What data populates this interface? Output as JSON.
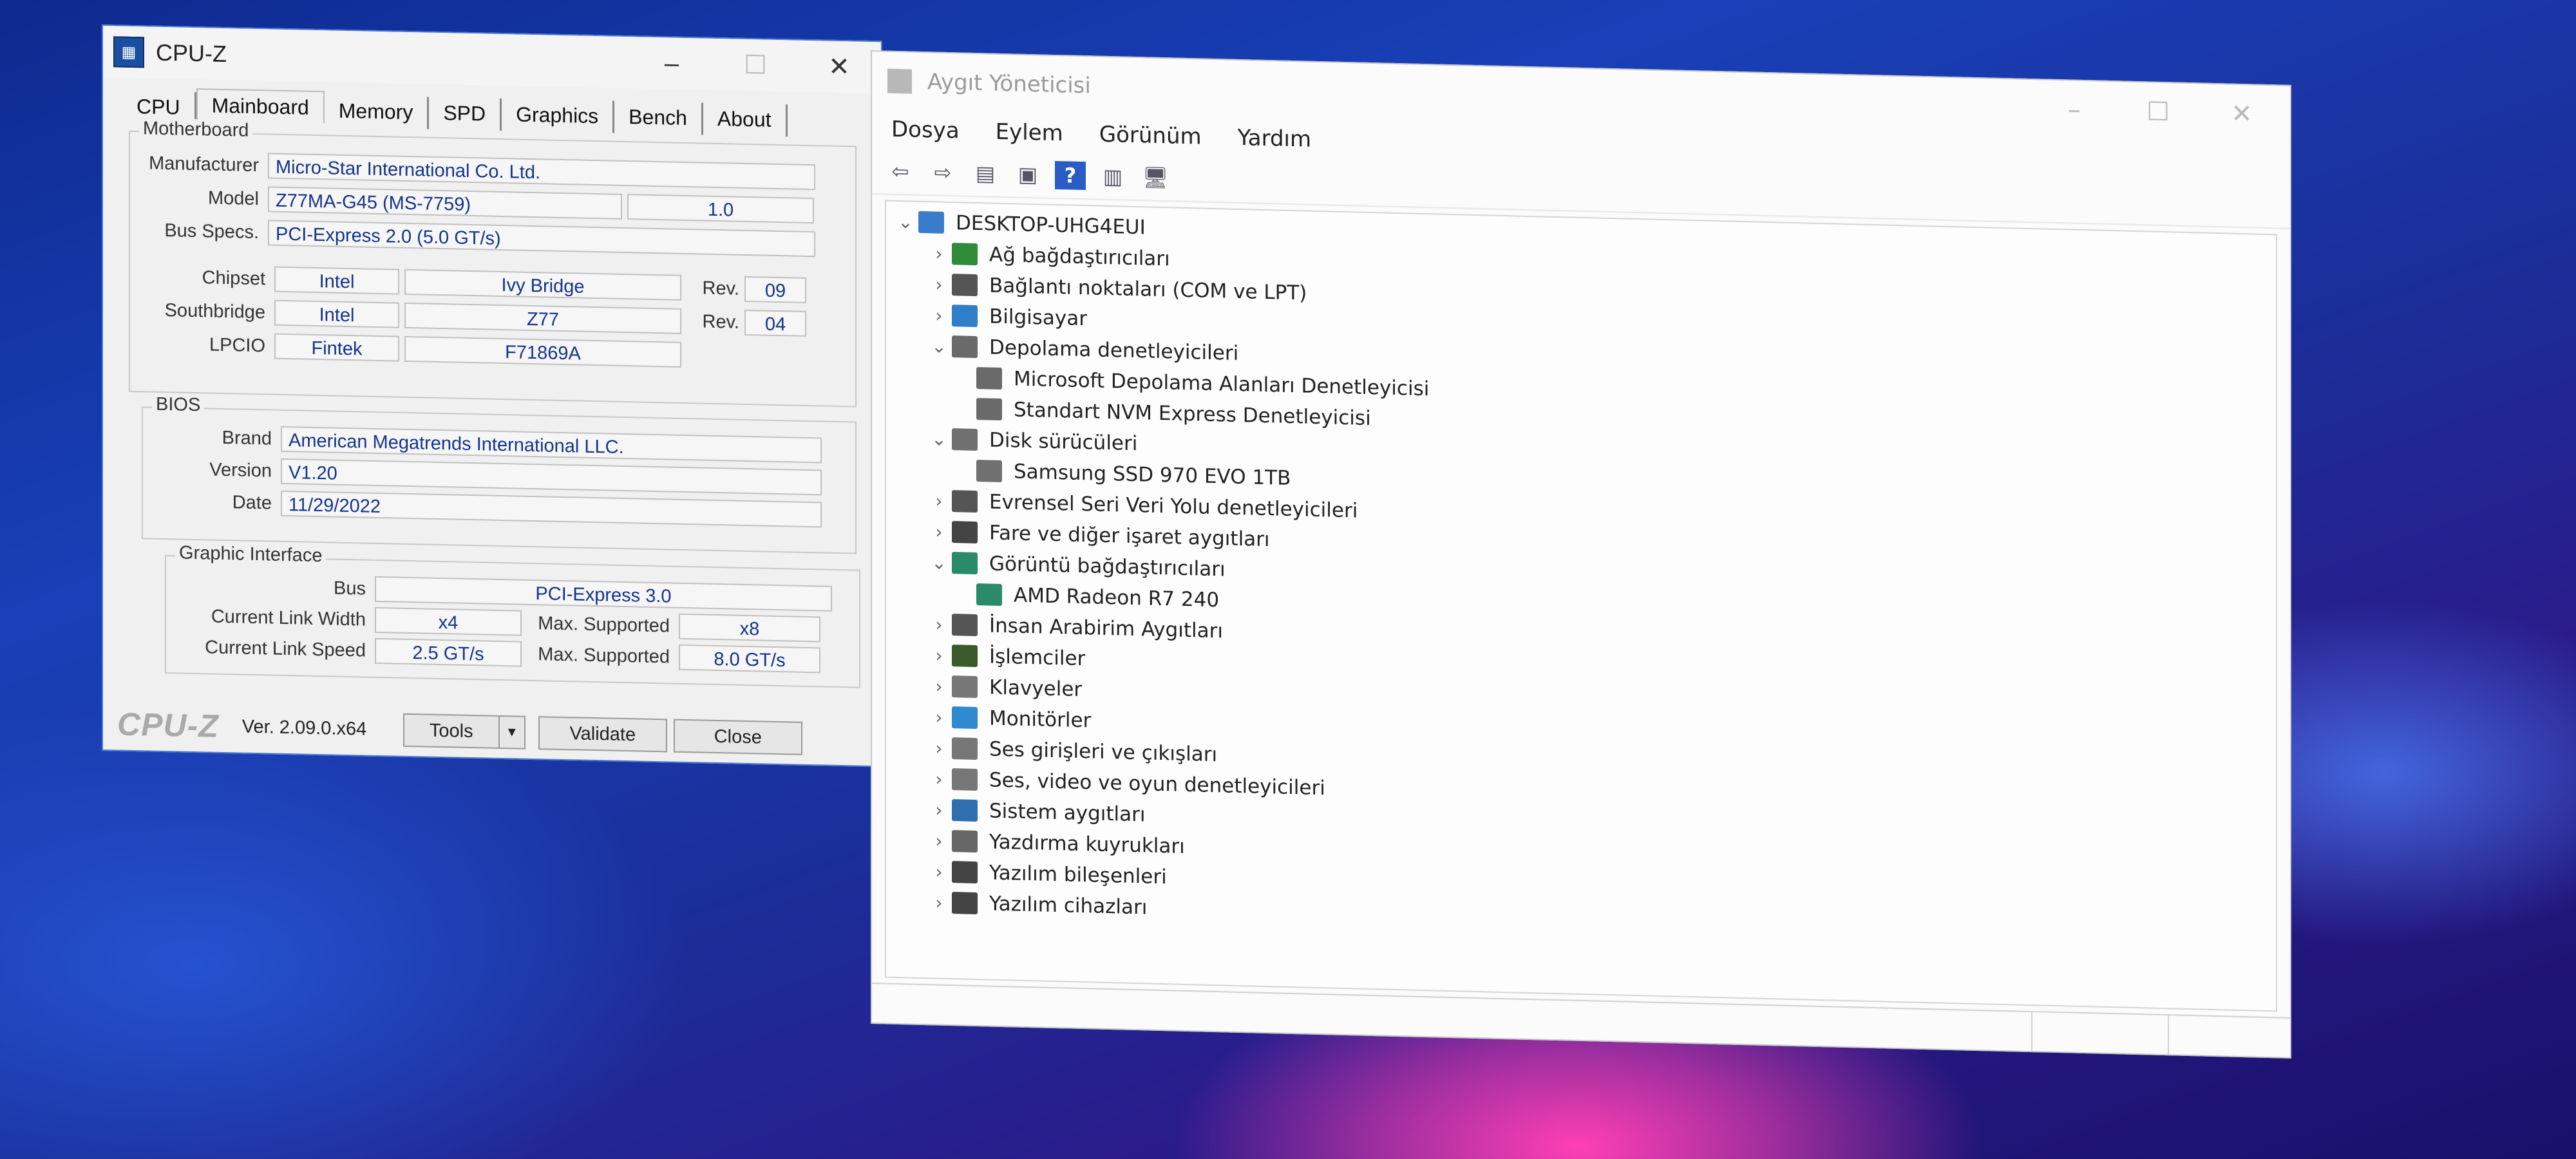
{
  "cpuz": {
    "title": "CPU-Z",
    "tabs": [
      "CPU",
      "Mainboard",
      "Memory",
      "SPD",
      "Graphics",
      "Bench",
      "About"
    ],
    "active_tab": "Mainboard",
    "motherboard": {
      "group_label": "Motherboard",
      "manufacturer_label": "Manufacturer",
      "manufacturer": "Micro-Star International Co. Ltd.",
      "model_label": "Model",
      "model": "Z77MA-G45 (MS-7759)",
      "model_rev": "1.0",
      "bus_label": "Bus Specs.",
      "bus": "PCI-Express 2.0 (5.0 GT/s)",
      "chipset_label": "Chipset",
      "chipset_vendor": "Intel",
      "chipset_name": "Ivy Bridge",
      "chipset_rev_label": "Rev.",
      "chipset_rev": "09",
      "southbridge_label": "Southbridge",
      "southbridge_vendor": "Intel",
      "southbridge_name": "Z77",
      "southbridge_rev_label": "Rev.",
      "southbridge_rev": "04",
      "lpcio_label": "LPCIO",
      "lpcio_vendor": "Fintek",
      "lpcio_name": "F71869A"
    },
    "bios": {
      "group_label": "BIOS",
      "brand_label": "Brand",
      "brand": "American Megatrends International LLC.",
      "version_label": "Version",
      "version": "V1.20",
      "date_label": "Date",
      "date": "11/29/2022"
    },
    "graphic": {
      "group_label": "Graphic Interface",
      "bus_label": "Bus",
      "bus": "PCI-Express 3.0",
      "link_width_label": "Current Link Width",
      "link_width": "x4",
      "max_supported_label": "Max. Supported",
      "max_width": "x8",
      "link_speed_label": "Current Link Speed",
      "link_speed": "2.5 GT/s",
      "max_speed": "8.0 GT/s"
    },
    "footer": {
      "logo": "CPU-Z",
      "version": "Ver. 2.09.0.x64",
      "tools": "Tools",
      "validate": "Validate",
      "close": "Close"
    }
  },
  "devmgr": {
    "title": "Aygıt Yöneticisi",
    "menu": [
      "Dosya",
      "Eylem",
      "Görünüm",
      "Yardım"
    ],
    "root": "DESKTOP-UHG4EUI",
    "nodes": [
      {
        "label": "Ağ bağdaştırıcıları",
        "expanded": false,
        "icon": "network-icon",
        "color": "#2f8a3a"
      },
      {
        "label": "Bağlantı noktaları (COM ve LPT)",
        "expanded": false,
        "icon": "port-icon",
        "color": "#555555"
      },
      {
        "label": "Bilgisayar",
        "expanded": false,
        "icon": "computer-icon",
        "color": "#2f7fc8"
      },
      {
        "label": "Depolama denetleyicileri",
        "expanded": true,
        "icon": "storage-controller-icon",
        "color": "#6a6a6a"
      },
      {
        "label": "Microsoft Depolama Alanları Denetleyicisi",
        "child": true,
        "icon": "storage-controller-icon",
        "color": "#6a6a6a"
      },
      {
        "label": "Standart NVM Express Denetleyicisi",
        "child": true,
        "icon": "storage-controller-icon",
        "color": "#6a6a6a"
      },
      {
        "label": "Disk sürücüleri",
        "expanded": true,
        "icon": "disk-icon",
        "color": "#707070"
      },
      {
        "label": "Samsung SSD 970 EVO 1TB",
        "child": true,
        "icon": "disk-icon",
        "color": "#707070"
      },
      {
        "label": "Evrensel Seri Veri Yolu denetleyicileri",
        "expanded": false,
        "icon": "usb-icon",
        "color": "#555555"
      },
      {
        "label": "Fare ve diğer işaret aygıtları",
        "expanded": false,
        "icon": "mouse-icon",
        "color": "#444444"
      },
      {
        "label": "Görüntü bağdaştırıcıları",
        "expanded": true,
        "icon": "display-adapter-icon",
        "color": "#2a8a6a"
      },
      {
        "label": "AMD Radeon R7 240",
        "child": true,
        "icon": "display-adapter-icon",
        "color": "#2a8a6a"
      },
      {
        "label": "İnsan Arabirim Aygıtları",
        "expanded": false,
        "icon": "hid-icon",
        "color": "#555555"
      },
      {
        "label": "İşlemciler",
        "expanded": false,
        "icon": "processor-icon",
        "color": "#3a5a2a"
      },
      {
        "label": "Klavyeler",
        "expanded": false,
        "icon": "keyboard-icon",
        "color": "#777777"
      },
      {
        "label": "Monitörler",
        "expanded": false,
        "icon": "monitor-icon",
        "color": "#2f8ad0"
      },
      {
        "label": "Ses girişleri ve çıkışları",
        "expanded": false,
        "icon": "speaker-icon",
        "color": "#777777"
      },
      {
        "label": "Ses, video ve oyun denetleyicileri",
        "expanded": false,
        "icon": "speaker-icon",
        "color": "#777777"
      },
      {
        "label": "Sistem aygıtları",
        "expanded": false,
        "icon": "system-device-icon",
        "color": "#2f6fb0"
      },
      {
        "label": "Yazdırma kuyrukları",
        "expanded": false,
        "icon": "printer-icon",
        "color": "#666666"
      },
      {
        "label": "Yazılım bileşenleri",
        "expanded": false,
        "icon": "software-component-icon",
        "color": "#444444"
      },
      {
        "label": "Yazılım cihazları",
        "expanded": false,
        "icon": "software-device-icon",
        "color": "#444444"
      }
    ]
  }
}
